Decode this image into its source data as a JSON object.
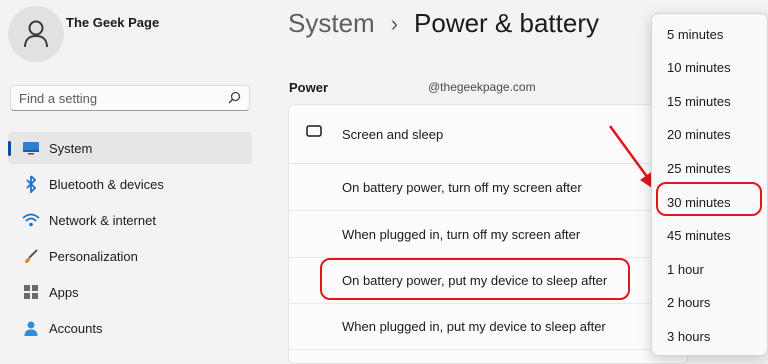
{
  "profile": {
    "name": "The Geek Page"
  },
  "search": {
    "placeholder": "Find a setting"
  },
  "sidebar": {
    "items": [
      {
        "label": "System",
        "icon": "monitor-icon",
        "selected": true
      },
      {
        "label": "Bluetooth & devices",
        "icon": "bluetooth-icon"
      },
      {
        "label": "Network & internet",
        "icon": "wifi-icon"
      },
      {
        "label": "Personalization",
        "icon": "brush-icon"
      },
      {
        "label": "Apps",
        "icon": "apps-icon"
      },
      {
        "label": "Accounts",
        "icon": "person-icon"
      }
    ]
  },
  "breadcrumb": {
    "parent": "System",
    "separator": "›",
    "current": "Power & battery"
  },
  "main": {
    "section_title": "Power",
    "watermark": "@thegeekpage.com",
    "card": {
      "header": "Screen and sleep",
      "rows": [
        "On battery power, turn off my screen after",
        "When plugged in, turn off my screen after",
        "On battery power, put my device to sleep after",
        "When plugged in, put my device to sleep after"
      ]
    }
  },
  "dropdown": {
    "options": [
      "5 minutes",
      "10 minutes",
      "15 minutes",
      "20 minutes",
      "25 minutes",
      "30 minutes",
      "45 minutes",
      "1 hour",
      "2 hours",
      "3 hours"
    ],
    "highlighted": "30 minutes"
  },
  "colors": {
    "accent": "#0a4c9a",
    "annotation_red": "#e0161d"
  }
}
